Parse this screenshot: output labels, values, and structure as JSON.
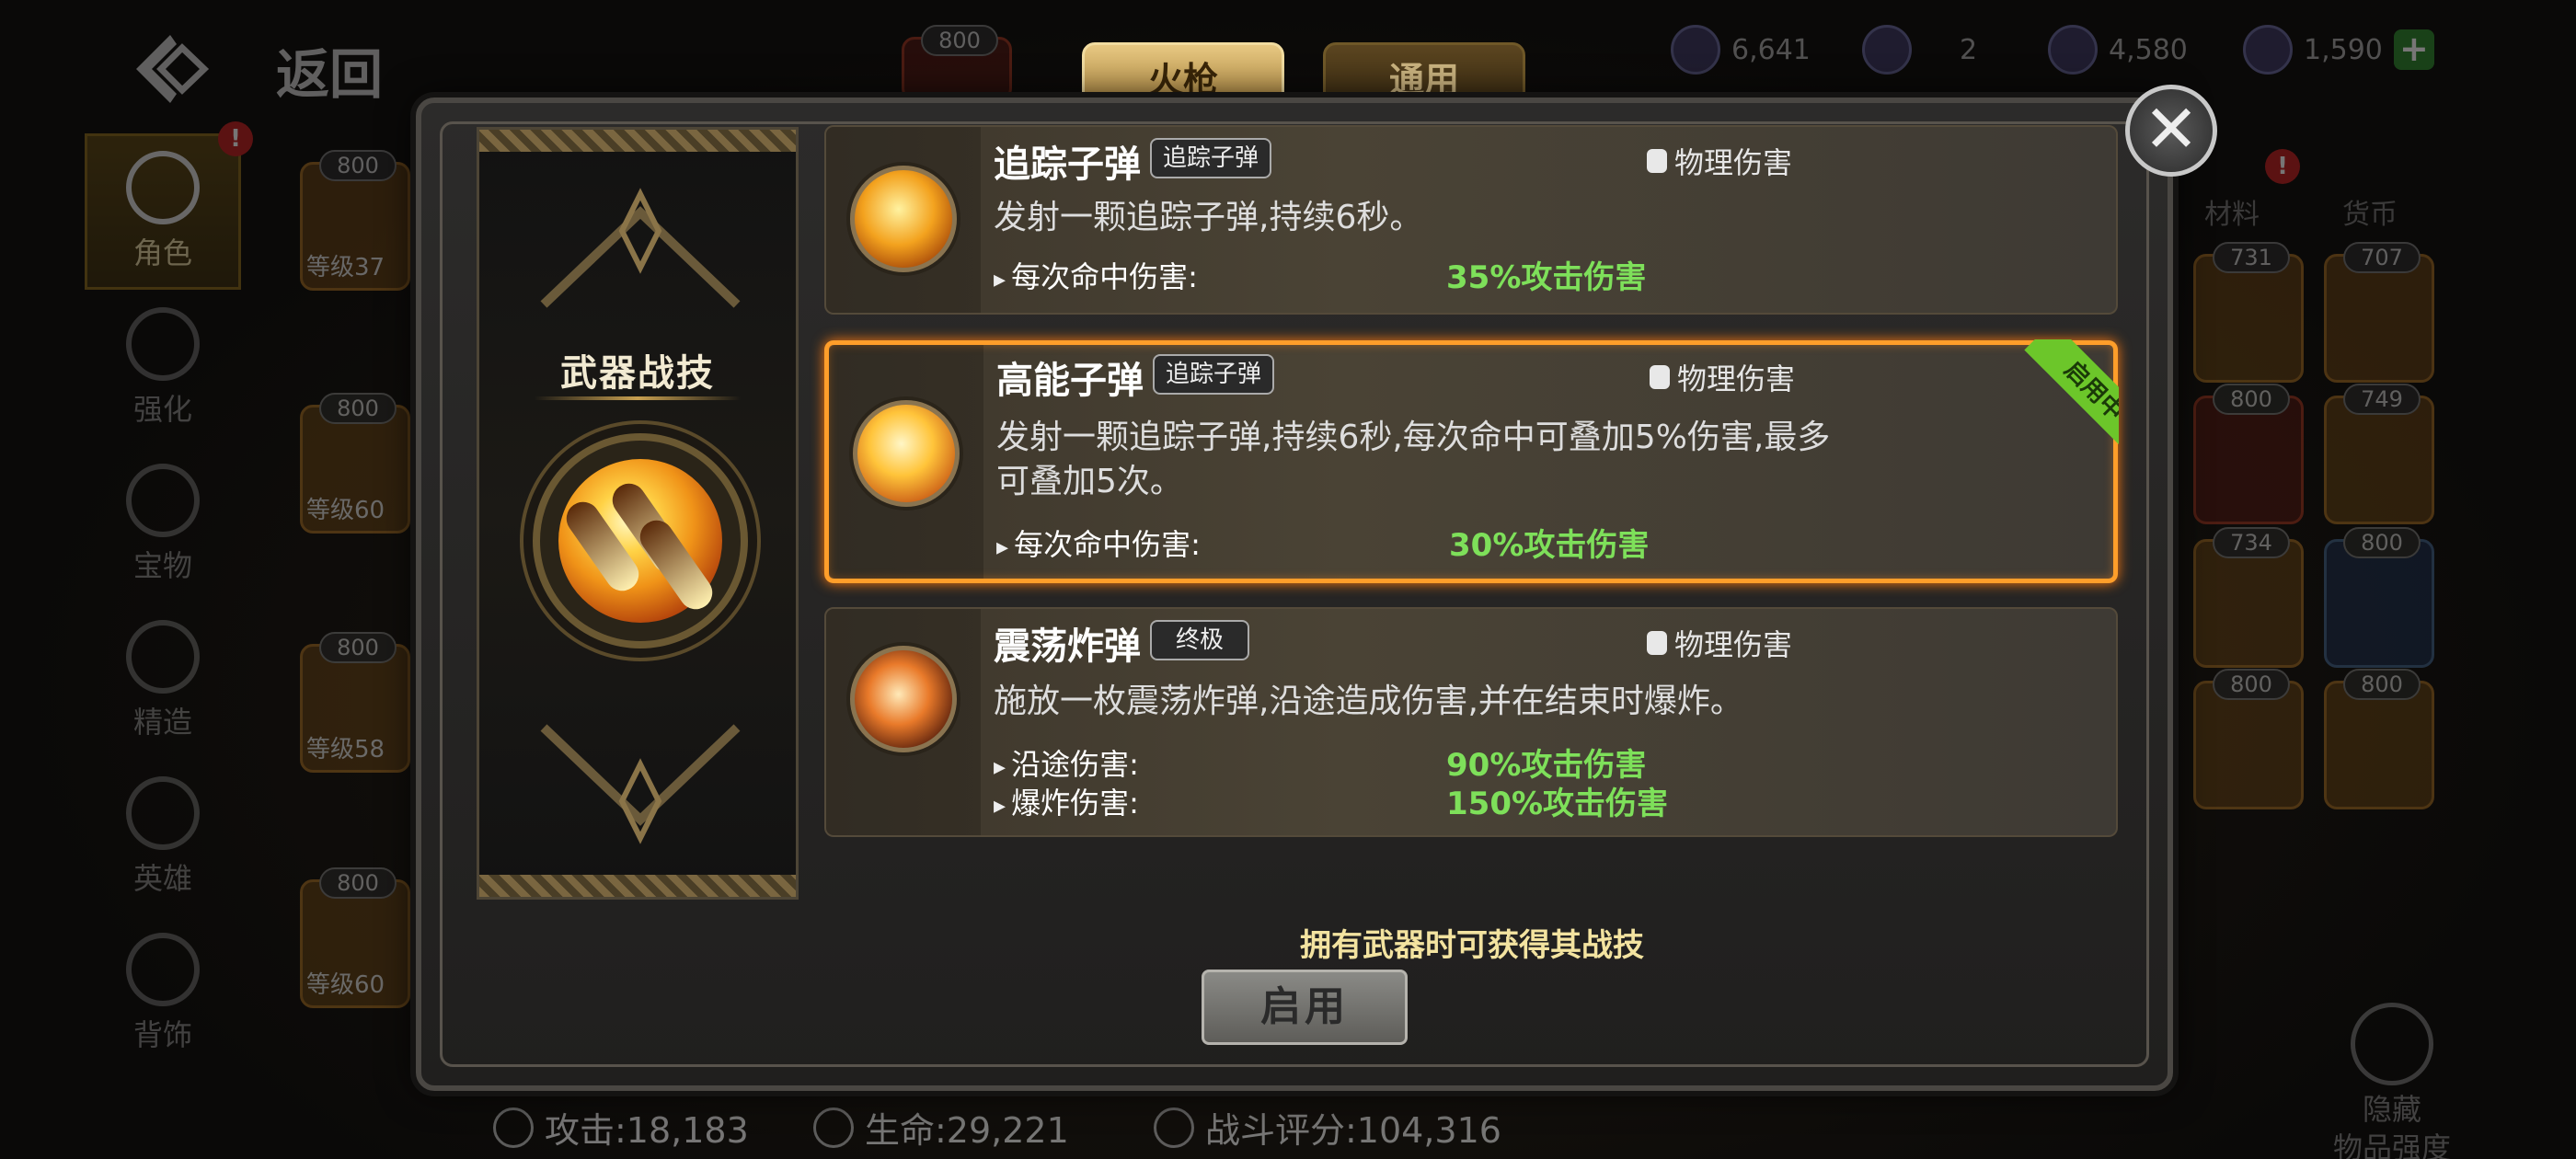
{
  "header": {
    "back_label": "返回"
  },
  "sidebar": {
    "items": [
      {
        "label": "角色"
      },
      {
        "label": "强化"
      },
      {
        "label": "宝物"
      },
      {
        "label": "精造"
      },
      {
        "label": "英雄"
      },
      {
        "label": "背饰"
      }
    ],
    "alert": "!"
  },
  "inventory_cards": [
    {
      "badge": "800",
      "level": "等级37"
    },
    {
      "badge": "800",
      "level": "等级60"
    },
    {
      "badge": "800",
      "level": "等级58"
    },
    {
      "badge": "800",
      "level": "等级60"
    }
  ],
  "top_badge": "800",
  "tabs": [
    {
      "label": "火枪"
    },
    {
      "label": "通用"
    }
  ],
  "currencies": [
    {
      "value": "6,641"
    },
    {
      "value": "2"
    },
    {
      "value": "4,580"
    },
    {
      "value": "1,590"
    }
  ],
  "right_tabs": {
    "materials": "材料",
    "currency": "货币",
    "alert": "!"
  },
  "right_cards": [
    "731",
    "707",
    "800",
    "749",
    "734",
    "800",
    "800",
    "800"
  ],
  "modal": {
    "art_title": "武器战技",
    "skills": [
      {
        "name": "追踪子弹",
        "tag": "追踪子弹",
        "damage_type": "物理伤害",
        "description": "发射一颗追踪子弹,持续6秒。",
        "stats": [
          {
            "label": "每次命中伤害:",
            "value": "35%攻击伤害"
          }
        ],
        "selected": false
      },
      {
        "name": "高能子弹",
        "tag": "追踪子弹",
        "damage_type": "物理伤害",
        "description_line1": "发射一颗追踪子弹,持续6秒,每次命中可叠加5%伤害,最多",
        "description_line2": "可叠加5次。",
        "stats": [
          {
            "label": "每次命中伤害:",
            "value": "30%攻击伤害"
          }
        ],
        "selected": true,
        "ribbon": "启用中"
      },
      {
        "name": "震荡炸弹",
        "tag": "终极",
        "damage_type": "物理伤害",
        "description": "施放一枚震荡炸弹,沿途造成伤害,并在结束时爆炸。",
        "stats": [
          {
            "label": "沿途伤害:",
            "value": "90%攻击伤害"
          },
          {
            "label": "爆炸伤害:",
            "value": "150%攻击伤害"
          }
        ],
        "selected": false
      }
    ],
    "hint": "拥有武器时可获得其战技",
    "enable_button": "启用",
    "close_symbol": "✕"
  },
  "footer_stats": {
    "attack": "攻击:18,183",
    "hp": "生命:29,221",
    "score": "战斗评分:104,316"
  },
  "hide_button": {
    "line1": "隐藏",
    "line2": "物品强度"
  },
  "colors": {
    "accent_orange": "#ff9e2a",
    "damage_green": "#7ee05a",
    "active_ribbon": "#6cc62a"
  }
}
